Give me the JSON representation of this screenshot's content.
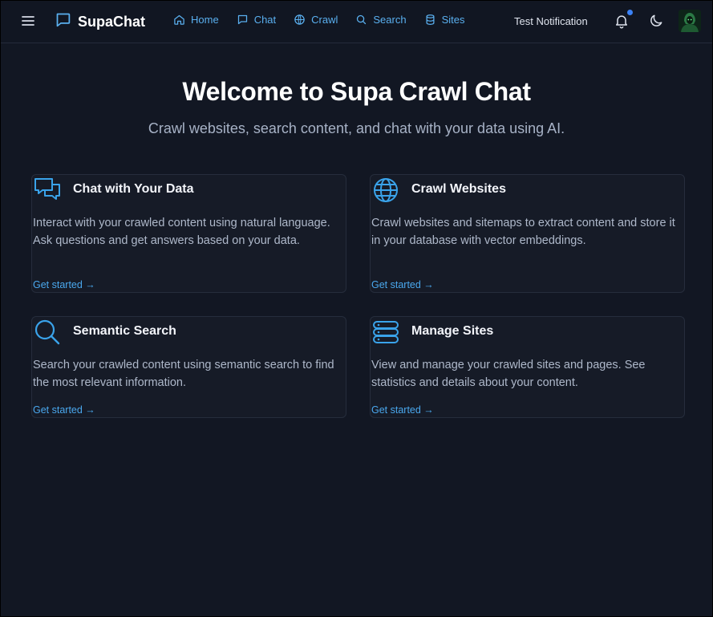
{
  "header": {
    "brand": "SupaChat",
    "nav": [
      {
        "label": "Home",
        "icon": "home-icon"
      },
      {
        "label": "Chat",
        "icon": "chat-icon"
      },
      {
        "label": "Crawl",
        "icon": "globe-icon"
      },
      {
        "label": "Search",
        "icon": "search-icon"
      },
      {
        "label": "Sites",
        "icon": "database-icon"
      }
    ],
    "notification_label": "Test Notification"
  },
  "hero": {
    "title": "Welcome to Supa Crawl Chat",
    "subtitle": "Crawl websites, search content, and chat with your data using AI."
  },
  "cards": [
    {
      "title": "Chat with Your Data",
      "icon": "chat-bubbles-icon",
      "description": "Interact with your crawled content using natural language. Ask questions and get answers based on your data.",
      "link": "Get started →"
    },
    {
      "title": "Crawl Websites",
      "icon": "globe-icon",
      "description": "Crawl websites and sitemaps to extract content and store it in your database with vector embeddings.",
      "link": "Get started →"
    },
    {
      "title": "Semantic Search",
      "icon": "search-icon",
      "description": "Search your crawled content using semantic search to find the most relevant information.",
      "link": "Get started →"
    },
    {
      "title": "Manage Sites",
      "icon": "database-icon",
      "description": "View and manage your crawled sites and pages. See statistics and details about your content.",
      "link": "Get started →"
    }
  ],
  "colors": {
    "background": "#121723",
    "accent": "#4aa8ee",
    "card": "#161b27",
    "notification_dot": "#3b82f6"
  }
}
